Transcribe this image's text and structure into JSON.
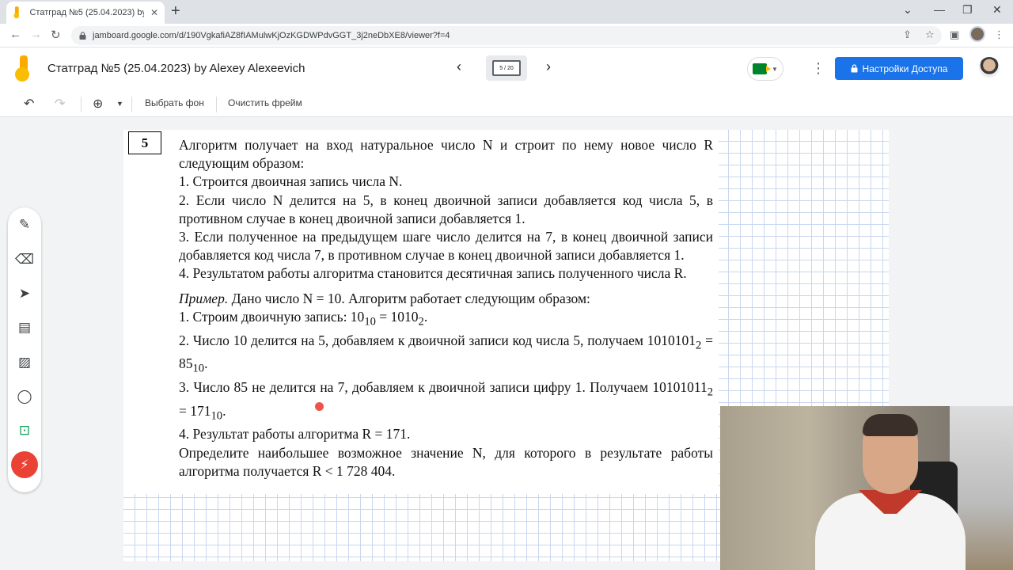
{
  "browser": {
    "tab_title": "Статград №5 (25.04.2023) by Alexey Alexeevich",
    "url": "jamboard.google.com/d/190VgkafiAZ8fIAMulwKjOzKGDWPdvGGT_3j2neDbXE8/viewer?f=4"
  },
  "app": {
    "doc_title": "Статград №5 (25.04.2023) by Alexey Alexeevich",
    "page_indicator": "5 / 20",
    "share_label": "Настройки Доступа"
  },
  "toolbar": {
    "background_label": "Выбрать фон",
    "clear_label": "Очистить фрейм"
  },
  "task": {
    "number": "5",
    "intro": "Алгоритм получает на вход натуральное число N и строит по нему новое число R следующим образом:",
    "steps": [
      "1. Строится двоичная запись числа N.",
      "2. Если число N делится на 5, в конец двоичной записи добавляется код числа 5, в противном случае в конец двоичной записи добавляется 1.",
      "3. Если полученное на предыдущем шаге число делится на 7, в конец двоичной записи добавляется код числа 7, в противном случае в конец двоичной записи добавляется 1.",
      "4. Результатом работы алгоритма становится десятичная запись полученного числа R."
    ],
    "example_word": "Пример.",
    "example_intro": "Дано число N = 10. Алгоритм работает следующим образом:",
    "ex1_text": "1. Строим двоичную запись: 10",
    "ex1_sub1": "10",
    "ex1_mid": " = 1010",
    "ex1_sub2": "2",
    "ex2_text": "2. Число 10 делится на 5, добавляем к двоичной записи код числа 5, получаем 1010101",
    "ex2_sub1": "2",
    "ex2_mid": " = 85",
    "ex2_sub2": "10",
    "ex3_text": "3. Число 85 не делится на 7, добавляем к двоичной записи цифру 1. Получаем 10101011",
    "ex3_sub1": "2",
    "ex3_mid": " = 171",
    "ex3_sub2": "10",
    "ex4": "4. Результат работы алгоритма R = 171.",
    "question": "Определите наибольшее возможное значение N, для которого в результате работы алгоритма получается R < 1 728 404."
  },
  "icons": {
    "pen": "pen-icon",
    "eraser": "eraser-icon",
    "select": "cursor-icon",
    "sticky": "sticky-note-icon",
    "image": "image-icon",
    "shape": "circle-icon",
    "textbox": "textbox-icon",
    "laser": "laser-icon"
  },
  "colors": {
    "accent": "#1a73e8",
    "grid": "#c9d7ee",
    "laser": "#ea4335"
  }
}
